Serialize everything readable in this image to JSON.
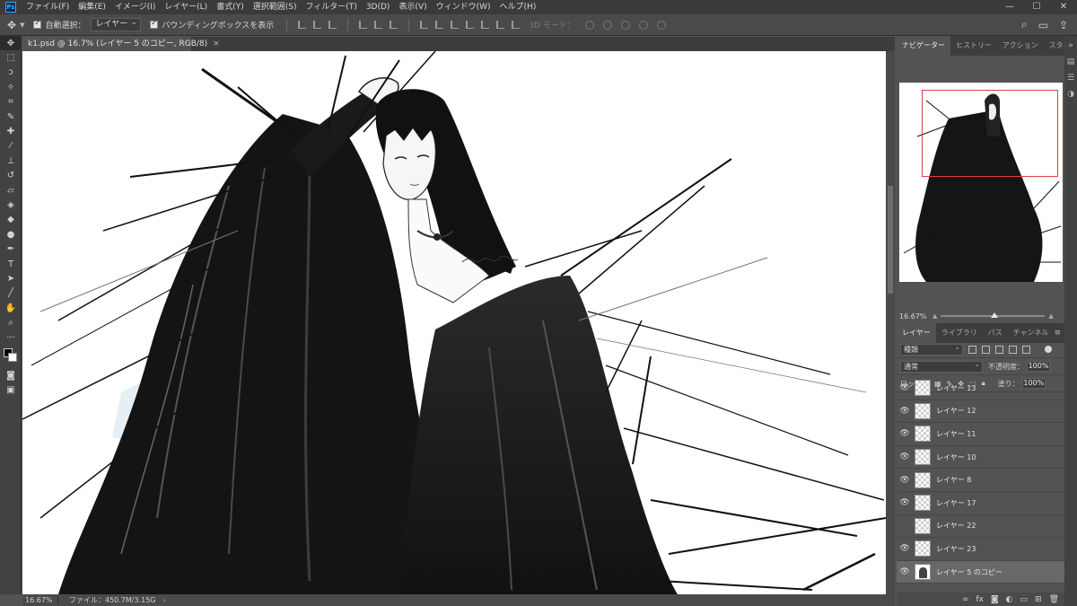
{
  "app": {
    "logo": "Ps",
    "menu": [
      "ファイル(F)",
      "編集(E)",
      "イメージ(I)",
      "レイヤー(L)",
      "書式(Y)",
      "選択範囲(S)",
      "フィルター(T)",
      "3D(D)",
      "表示(V)",
      "ウィンドウ(W)",
      "ヘルプ(H)"
    ],
    "window_controls": [
      "—",
      "☐",
      "✕"
    ]
  },
  "options": {
    "auto_select_label": "自動選択：",
    "auto_select_value": "レイヤー",
    "bounding_box_label": "バウンディングボックスを表示",
    "mode_3d_label": "3D モード："
  },
  "document": {
    "tab_title": "k1.psd @ 16.7% (レイヤー 5 のコピー, RGB/8)",
    "close_glyph": "×"
  },
  "status": {
    "zoom": "16.67%",
    "file_info": "ファイル：450.7M/3.15G",
    "arrow": "›"
  },
  "navigator": {
    "tabs": [
      "ナビゲーター",
      "ヒストリー",
      "アクション",
      "スタイル"
    ],
    "zoom": "16.67%"
  },
  "layers_panel": {
    "tabs": [
      "レイヤー",
      "ライブラリ",
      "パス",
      "チャンネル"
    ],
    "filter_kind": "種類",
    "blend_mode": "通常",
    "opacity_label": "不透明度：",
    "opacity_value": "100%",
    "lock_label": "ロック：",
    "fill_label": "塗り：",
    "fill_value": "100%",
    "layers": [
      {
        "name": "レイヤー 13",
        "visible": true,
        "selected": false,
        "thumb": "transparent"
      },
      {
        "name": "レイヤー 12",
        "visible": true,
        "selected": false,
        "thumb": "transparent"
      },
      {
        "name": "レイヤー 11",
        "visible": true,
        "selected": false,
        "thumb": "transparent"
      },
      {
        "name": "レイヤー 10",
        "visible": true,
        "selected": false,
        "thumb": "transparent"
      },
      {
        "name": "レイヤー 8",
        "visible": true,
        "selected": false,
        "thumb": "transparent"
      },
      {
        "name": "レイヤー 17",
        "visible": true,
        "selected": false,
        "thumb": "transparent"
      },
      {
        "name": "レイヤー 22",
        "visible": false,
        "selected": false,
        "thumb": "transparent"
      },
      {
        "name": "レイヤー 23",
        "visible": true,
        "selected": false,
        "thumb": "transparent"
      },
      {
        "name": "レイヤー 5 のコピー",
        "visible": true,
        "selected": true,
        "thumb": "art"
      }
    ],
    "footer_icons": [
      "link-icon",
      "fx-icon",
      "mask-icon",
      "adjustment-icon",
      "folder-icon",
      "new-layer-icon",
      "trash-icon"
    ]
  }
}
